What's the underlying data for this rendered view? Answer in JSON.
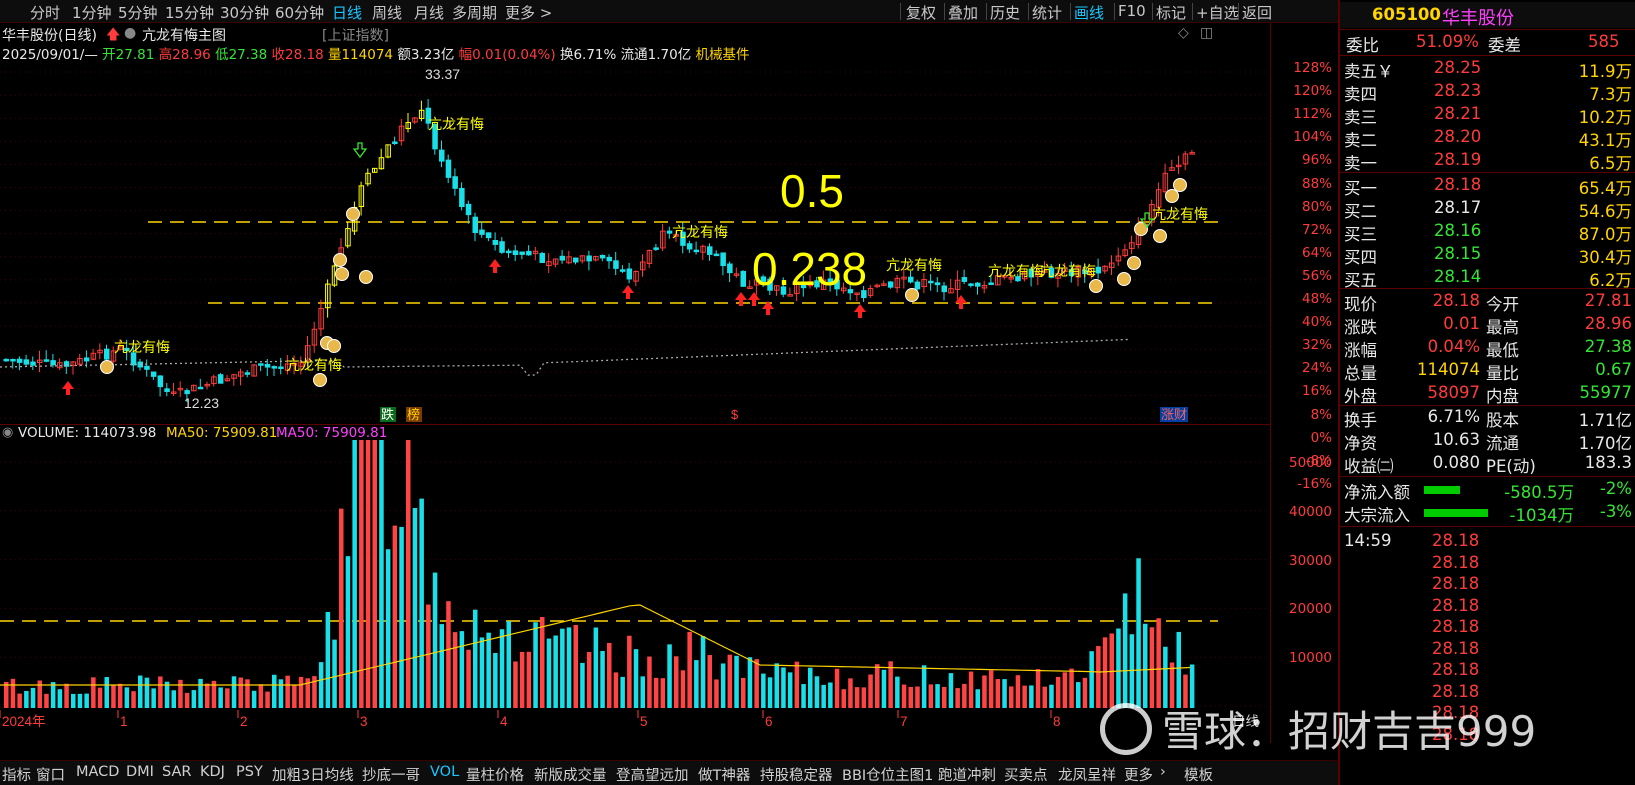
{
  "toolbar_left": [
    "分时",
    "1分钟",
    "5分钟",
    "15分钟",
    "30分钟",
    "60分钟",
    "日线",
    "周线",
    "月线",
    "多周期",
    "更多 >"
  ],
  "toolbar_active": "日线",
  "toolbar_right": [
    "复权",
    "叠加",
    "历史",
    "统计",
    "画线",
    "F10",
    "标记",
    "+自选",
    "返回"
  ],
  "toolbar_right_active": "画线",
  "title": {
    "stock": "华丰股份(日线)",
    "indicator": "亢龙有悔主图",
    "index_tag": "[上证指数]"
  },
  "quote_line": {
    "date": "2025/09/01/—",
    "open_label": "开",
    "open": "27.81",
    "high_label": "高",
    "high": "28.96",
    "low_label": "低",
    "low": "27.38",
    "close_label": "收",
    "close": "28.18",
    "vol_label": "量",
    "vol": "114074",
    "amt_label": "额",
    "amt": "3.23亿",
    "chg_label": "幅",
    "chg": "0.01(0.04%)",
    "turn_label": "换",
    "turn": "6.71%",
    "float_label": "流通",
    "float": "1.70亿",
    "sector": "机械基件"
  },
  "price_axis": [
    "128%",
    "120%",
    "112%",
    "104%",
    "96%",
    "88%",
    "80%",
    "72%",
    "64%",
    "56%",
    "48%",
    "40%",
    "32%",
    "24%",
    "16%",
    "8%",
    "0%",
    "-8%",
    "-16%"
  ],
  "vol_axis": [
    "50000",
    "40000",
    "30000",
    "20000",
    "10000"
  ],
  "annotations": {
    "fib_05": "0.5",
    "fib_0238": "0.238",
    "signal": "亢龙有悔",
    "max_label": "33.37",
    "min_label": "12.23"
  },
  "bottom_markers": [
    "跌",
    "榜",
    "$",
    "涨财"
  ],
  "vol_header": {
    "name": "VOLUME: 114073.98",
    "ma1": "MA50: 75909.81",
    "ma2": "MA50: 75909.81"
  },
  "time_axis": [
    "2024年",
    "1",
    "2",
    "3",
    "4",
    "5",
    "6",
    "7",
    "8",
    "日线"
  ],
  "bottom_tabs": [
    "指标",
    "窗口",
    "MACD",
    "DMI",
    "SAR",
    "KDJ",
    "PSY",
    "加粗3日均线",
    "抄底一哥",
    "VOL",
    "量柱价格",
    "新版成交量",
    "登高望远加",
    "做T神器",
    "持股稳定器",
    "BBI仓位主图1",
    "跑道冲刺",
    "买卖点",
    "龙凤呈祥",
    "更多",
    "›",
    "模板"
  ],
  "bottom_active": "VOL",
  "right_panel": {
    "code": "605100",
    "name": "华丰股份",
    "weibi_label": "委比",
    "weibi": "51.09%",
    "weicha_label": "委差",
    "weicha": "585",
    "sell": [
      [
        "卖五￥",
        "28.25",
        "11.9万"
      ],
      [
        "卖四",
        "28.23",
        "7.3万"
      ],
      [
        "卖三",
        "28.21",
        "10.2万"
      ],
      [
        "卖二",
        "28.20",
        "43.1万"
      ],
      [
        "卖一",
        "28.19",
        "6.5万"
      ]
    ],
    "buy": [
      [
        "买一",
        "28.18",
        "65.4万"
      ],
      [
        "买二",
        "28.17",
        "54.6万"
      ],
      [
        "买三",
        "28.16",
        "87.0万"
      ],
      [
        "买四",
        "28.15",
        "30.4万"
      ],
      [
        "买五",
        "28.14",
        "6.2万"
      ]
    ],
    "stats": [
      [
        "现价",
        "28.18",
        "今开",
        "27.81"
      ],
      [
        "涨跌",
        "0.01",
        "最高",
        "28.96"
      ],
      [
        "涨幅",
        "0.04%",
        "最低",
        "27.38"
      ],
      [
        "总量",
        "114074",
        "量比",
        "0.67"
      ],
      [
        "外盘",
        "58097",
        "内盘",
        "55977"
      ]
    ],
    "stats2": [
      [
        "换手",
        "6.71%",
        "股本",
        "1.71亿"
      ],
      [
        "净资",
        "10.63",
        "流通",
        "1.70亿"
      ],
      [
        "收益㈡",
        "0.080",
        "PE(动)",
        "183.3"
      ]
    ],
    "flows": [
      [
        "净流入额",
        "-580.5万",
        "-2%"
      ],
      [
        "大宗流入",
        "-1034万",
        "-3%"
      ]
    ],
    "tick_time": "14:59",
    "ticks": [
      "28.18",
      "28.18",
      "28.18",
      "28.18",
      "28.18",
      "28.18",
      "28.18",
      "28.18",
      "28.18",
      "28.18"
    ]
  },
  "watermark": "雪球：招财吉吉999",
  "colors": {
    "up": "#ff3b3b",
    "down": "#19e0e8",
    "accent": "#19c6ff",
    "yellow": "#ffd400",
    "grid": "#5a0000"
  },
  "chart_data": {
    "type": "candlestick",
    "y_axis_unit": "percent change from base 12.23-range",
    "price_range": [
      12.23,
      33.37
    ],
    "series": [
      {
        "name": "VOLUME",
        "values": []
      }
    ]
  }
}
